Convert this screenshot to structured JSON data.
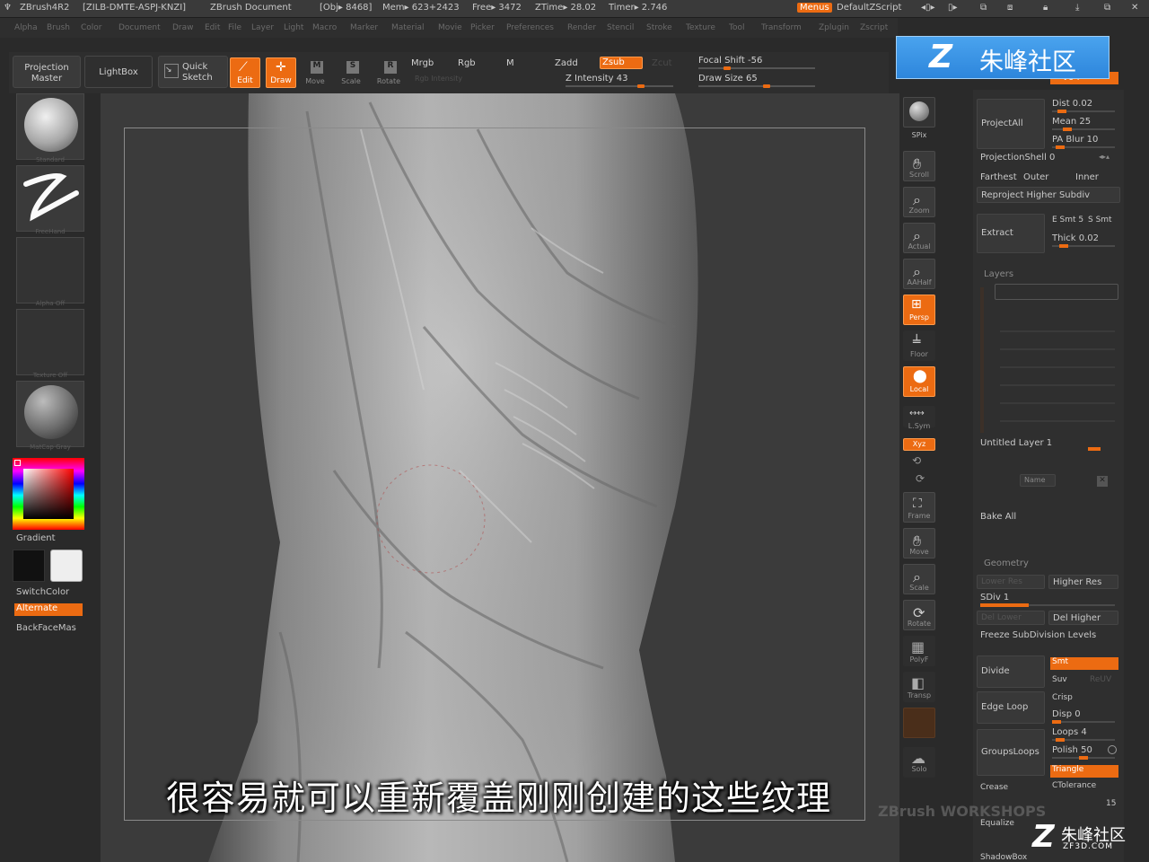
{
  "titlebar": {
    "app": "ZBrush4R2",
    "serial": "[ZILB-DMTE-ASPJ-KNZI]",
    "doc": "ZBrush Document",
    "obj": "[Obj▸ 8468]",
    "mem": "Mem▸ 623+2423",
    "free": "Free▸ 3472",
    "ztime": "ZTime▸ 28.02",
    "timer": "Timer▸ 2.746",
    "menus": "Menus",
    "script": "DefaultZScript"
  },
  "menubar": [
    "Alpha",
    "Brush",
    "Color",
    "Document",
    "Draw",
    "Edit",
    "File",
    "Layer",
    "Light",
    "Macro",
    "Marker",
    "Material",
    "Movie",
    "Picker",
    "Preferences",
    "Render",
    "Stencil",
    "Stroke",
    "Texture",
    "Tool",
    "Transform",
    "Zplugin",
    "Zscript"
  ],
  "toolbar": {
    "projection_master": "Projection Master",
    "lightbox": "LightBox",
    "quick_sketch": "Quick Sketch",
    "edit": "Edit",
    "draw": "Draw",
    "move": "Move",
    "scale": "Scale",
    "rotate": "Rotate",
    "mrgb": "Mrgb",
    "rgb": "Rgb",
    "m": "M",
    "zadd": "Zadd",
    "zsub": "Zsub",
    "zcut": "Zcut",
    "z_intensity": "Z Intensity 43",
    "focal_shift": "Focal Shift -56",
    "draw_size": "Draw Size 65",
    "rgb_intensity": "Rgb Intensity"
  },
  "left_shelf": {
    "brush_label": "Standard",
    "stroke_label": "FreeHand",
    "alpha_label": "Alpha Off",
    "texture_label": "Texture Off",
    "material_label": "MatCap Gray",
    "gradient": "Gradient",
    "switch_color": "SwitchColor",
    "alternate": "Alternate",
    "backface": "BackFaceMas"
  },
  "right_shelf": [
    "BPR",
    "SPix",
    "Scroll",
    "Zoom",
    "Actual",
    "AAHalf",
    "Persp",
    "Floor",
    "Local",
    "L.Sym",
    "Xyz",
    "",
    "",
    "Frame",
    "Move",
    "Scale",
    "Rotate",
    "PolyF",
    "Transp",
    "",
    "Solo"
  ],
  "rpanel": {
    "polygrp": "Polygrp",
    "dist": "Dist 0.02",
    "mean": "Mean 25",
    "pa_blur": "PA Blur 10",
    "project_all": "ProjectAll",
    "projection_shell": "ProjectionShell 0",
    "farthest": "Farthest",
    "outer": "Outer",
    "inner": "Inner",
    "reproject": "Reproject Higher Subdiv",
    "extract": "Extract",
    "e_smt": "E Smt 5",
    "s_smt": "S Smt",
    "thick": "Thick 0.02",
    "layers_title": "Layers",
    "untitled_layer": "Untitled Layer 1",
    "name_btn": "Name",
    "bake_all": "Bake All",
    "geometry_title": "Geometry",
    "lower_res": "Lower Res",
    "higher_res": "Higher Res",
    "sdiv": "SDiv 1",
    "del_lower": "Del Lower",
    "del_higher": "Del Higher",
    "freeze": "Freeze SubDivision Levels",
    "divide": "Divide",
    "smt": "Smt",
    "suv": "Suv",
    "relax": "ReUV",
    "edge_loop": "Edge Loop",
    "crisp": "Crisp",
    "disp": "Disp 0",
    "loops": "Loops 4",
    "grouploops": "GroupsLoops",
    "polish": "Polish 50",
    "triangle": "Triangle",
    "crease": "Crease",
    "ctolerance": "CTolerance",
    "fifteen": "15",
    "equalize": "Equalize",
    "shadowbox": "ShadowBox"
  },
  "watermark": {
    "top": "朱峰社区",
    "corner_main": "朱峰社区",
    "corner_sub": "ZF3D.COM",
    "workshops": "ZBrush WORKSHOPS"
  },
  "subtitle": "很容易就可以重新覆盖刚刚创建的这些纹理"
}
